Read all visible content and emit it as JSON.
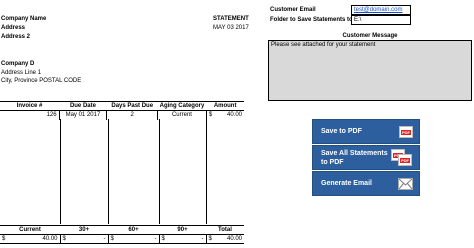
{
  "header": {
    "company_name": "Company Name",
    "address": "Address",
    "address2": "Address 2",
    "statement_label": "STATEMENT",
    "statement_date": "MAY 03 2017"
  },
  "customer": {
    "company": "Company D",
    "address_line": "Address Line 1",
    "city_line": "City, Province POSTAL CODE"
  },
  "email_panel": {
    "email_label": "Customer Email",
    "email_value": "test@domain.com",
    "folder_label": "Folder to Save Statements to",
    "folder_value": "E:\\",
    "message_title": "Customer Message",
    "message_text": "Please see attached for your statement"
  },
  "invoice_table": {
    "columns": [
      "Invoice #",
      "Due Date",
      "Days Past Due",
      "Aging Category",
      "Amount"
    ],
    "rows": [
      {
        "invoice": "126",
        "due_date": "May 01 2017",
        "days_past_due": "2",
        "aging": "Current",
        "currency": "$",
        "amount": "40.00"
      }
    ]
  },
  "aging_summary": {
    "columns": [
      "Current",
      "30+",
      "60+",
      "90+",
      "Total"
    ],
    "values": [
      {
        "currency": "$",
        "amount": "40.00"
      },
      {
        "currency": "$",
        "amount": "-"
      },
      {
        "currency": "$",
        "amount": "-"
      },
      {
        "currency": "$",
        "amount": "-"
      },
      {
        "currency": "$",
        "amount": "40.00"
      }
    ]
  },
  "buttons": {
    "save_pdf": "Save to PDF",
    "save_all_line1": "Save All Statements",
    "save_all_line2": "to PDF",
    "generate_email": "Generate Email",
    "pdf_tag": "PDF"
  },
  "colors": {
    "button_bg": "#2d5f9e",
    "message_bg": "#d9d9d9",
    "pdf_red": "#d22222"
  }
}
